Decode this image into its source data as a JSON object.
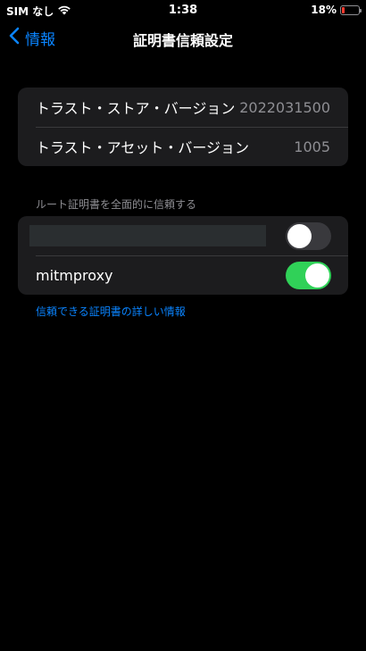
{
  "status_bar": {
    "carrier": "SIM なし",
    "time": "1:38",
    "battery_percent": "18%",
    "battery_level": 0.18,
    "battery_color": "#ff3b30"
  },
  "nav": {
    "back_label": "情報",
    "title": "証明書信頼設定"
  },
  "trust_info": [
    {
      "label": "トラスト・ストア・バージョン",
      "value": "2022031500"
    },
    {
      "label": "トラスト・アセット・バージョン",
      "value": "1005"
    }
  ],
  "full_trust": {
    "header": "ルート証明書を全面的に信頼する",
    "certificates": [
      {
        "label": "",
        "redacted": true,
        "enabled": false
      },
      {
        "label": "mitmproxy",
        "redacted": false,
        "enabled": true
      }
    ]
  },
  "footer_link": "信頼できる証明書の詳しい情報",
  "colors": {
    "accent": "#0a84ff",
    "toggle_on": "#30d158",
    "toggle_off": "#39393d",
    "cell_background": "#1c1c1e"
  },
  "icons": {
    "wifi": "wifi-icon",
    "back": "chevron-left-icon",
    "battery": "battery-icon"
  }
}
